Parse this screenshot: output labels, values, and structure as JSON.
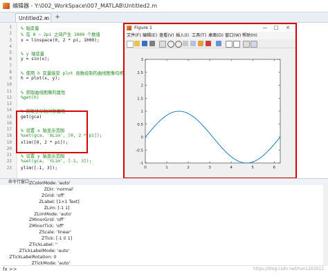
{
  "editor": {
    "title": "编辑器 - Y:\\002_WorkSpace\\007_MATLAB\\Untitled2.m",
    "tab_label": "Untitled2.m",
    "tab_close": "×",
    "tab_add": "+"
  },
  "code_lines": [
    {
      "n": "1",
      "text": "% 轴变量",
      "type": "cmt"
    },
    {
      "n": "2",
      "text": "% 在 0 ~ 2pi 之间产生 1000 个数值",
      "type": "cmt"
    },
    {
      "n": "3",
      "text": "x = linspace(0, 2 * pi, 1000);",
      "type": "plain"
    },
    {
      "n": "4",
      "text": "",
      "type": "plain"
    },
    {
      "n": "5",
      "text": "% y 轴变量",
      "type": "cmt"
    },
    {
      "n": "6",
      "text": "y = sin(x);",
      "type": "plain"
    },
    {
      "n": "7",
      "text": "",
      "type": "plain"
    },
    {
      "n": "8",
      "text": "% 使用 h 变量接受 plot 函数绘制的曲线图像句柄值",
      "type": "cmt"
    },
    {
      "n": "9",
      "text": "h = plot(x, y);",
      "type": "plain"
    },
    {
      "n": "10",
      "text": "",
      "type": "plain"
    },
    {
      "n": "11",
      "text": "% 获取曲线图像的属性",
      "type": "cmt"
    },
    {
      "n": "12",
      "text": "%get(h)",
      "type": "cmt"
    },
    {
      "n": "13",
      "text": "",
      "type": "plain"
    },
    {
      "n": "14",
      "text": "% 获取坐标轴对象属性",
      "type": "cmt"
    },
    {
      "n": "15",
      "text": "get(gca)",
      "type": "plain"
    },
    {
      "n": "16",
      "text": "",
      "type": "plain"
    },
    {
      "n": "17",
      "text": "% 设置 x 轴显示范围",
      "type": "cmt"
    },
    {
      "n": "18",
      "text": "%set(gca, 'XLim', [0, 2 * pi]);",
      "type": "cmt"
    },
    {
      "n": "19",
      "text": "xlim([0, 2 * pi]);",
      "type": "plain"
    },
    {
      "n": "20",
      "text": "",
      "type": "plain"
    },
    {
      "n": "21",
      "text": "% 设置 y 轴显示范围",
      "type": "cmt"
    },
    {
      "n": "22",
      "text": "%set(gca, 'YLim', [-1, 3]);",
      "type": "cmt"
    },
    {
      "n": "23",
      "text": "ylim([-1, 3]);",
      "type": "plain"
    }
  ],
  "command_window": {
    "header": "命令行窗口",
    "lines": [
      "ZColorMode: 'auto'",
      "ZDir: 'normal'",
      "ZGrid: 'off'",
      "ZLabel: [1×1 Text]",
      "ZLim: [-1 1]",
      "ZLimMode: 'auto'",
      "ZMinorGrid: 'off'",
      "ZMinorTick: 'off'",
      "ZScale: 'linear'",
      "ZTick: [-1 0 1]",
      "ZTickLabel: ''",
      "ZTickLabelMode: 'auto'",
      "ZTickLabelRotation: 0",
      "ZTickMode: 'auto'"
    ],
    "prompt": "fx >>",
    "watermark": "https://blog.csdn.net/han1202012"
  },
  "figure": {
    "title": "Figure 1",
    "minimize": "—",
    "maximize": "□",
    "close": "×",
    "menu": [
      "文件(F)",
      "编辑(E)",
      "查看(V)",
      "插入(I)",
      "工具(T)",
      "桌面(D)",
      "窗口(W)",
      "帮助(H)"
    ]
  },
  "chart_data": {
    "type": "line",
    "title": "",
    "xlabel": "",
    "ylabel": "",
    "xlim": [
      0,
      6.283
    ],
    "ylim": [
      -1,
      3
    ],
    "xticks": [
      "0",
      "1",
      "2",
      "3",
      "4",
      "5",
      "6"
    ],
    "yticks": [
      "-1",
      "-0.5",
      "0",
      "0.5",
      "1",
      "1.5",
      "2",
      "2.5",
      "3"
    ],
    "series": [
      {
        "function": "sin(x)",
        "color": "#0072bd",
        "x": [
          0,
          0.5,
          1,
          1.5708,
          2,
          2.5,
          3,
          3.1416,
          3.5,
          4,
          4.5,
          4.7124,
          5,
          5.5,
          6,
          6.2832
        ],
        "y": [
          0,
          0.479,
          0.841,
          1,
          0.909,
          0.598,
          0.141,
          0,
          -0.351,
          -0.757,
          -0.978,
          -1,
          -0.959,
          -0.706,
          -0.279,
          0
        ]
      }
    ]
  }
}
